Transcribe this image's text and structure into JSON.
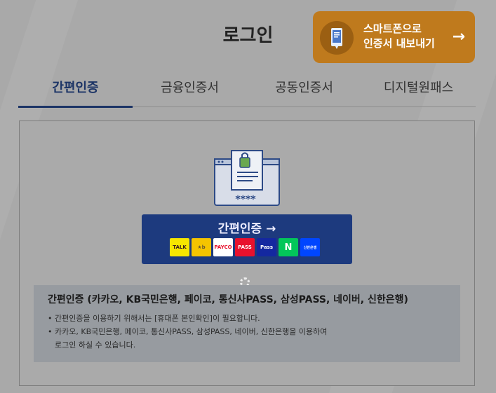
{
  "title": "로그인",
  "smart_button": {
    "line1": "스마트폰으로",
    "line2": "인증서 내보내기",
    "arrow": "→"
  },
  "tabs": [
    {
      "label": "간편인증",
      "active": true
    },
    {
      "label": "금융인증서",
      "active": false
    },
    {
      "label": "공동인증서",
      "active": false
    },
    {
      "label": "디지털원패스",
      "active": false
    }
  ],
  "illustration": {
    "password_mask": "****"
  },
  "auth_button": {
    "label": "간편인증 →",
    "logos": [
      {
        "name": "kakao",
        "text": "TALK",
        "bg": "#f7e600",
        "fg": "#3b1e1e"
      },
      {
        "name": "kb",
        "text": "★b",
        "bg": "#f5c400",
        "fg": "#6b5b2e"
      },
      {
        "name": "payco",
        "text": "PAYCO",
        "bg": "#ffffff",
        "fg": "#e8112d"
      },
      {
        "name": "pass-telecom",
        "text": "PASS",
        "bg": "#e8112d",
        "fg": "#ffffff"
      },
      {
        "name": "samsung-pass",
        "text": "Pass",
        "bg": "#1428a0",
        "fg": "#ffffff"
      },
      {
        "name": "naver",
        "text": "N",
        "bg": "#03c75a",
        "fg": "#ffffff"
      },
      {
        "name": "shinhan",
        "text": "신한은행",
        "bg": "#0046ff",
        "fg": "#ffffff"
      }
    ]
  },
  "info": {
    "title": "간편인증 (카카오, KB국민은행, 페이코, 통신사PASS, 삼성PASS, 네이버, 신한은행)",
    "lines": [
      "간편인증을 이용하기 위해서는 [휴대폰 본인확인]이 필요합니다.",
      "카카오, KB국민은행, 페이코, 통신사PASS, 삼성PASS, 네이버, 신한은행을 이용하여",
      "로그인 하실 수 있습니다."
    ]
  }
}
